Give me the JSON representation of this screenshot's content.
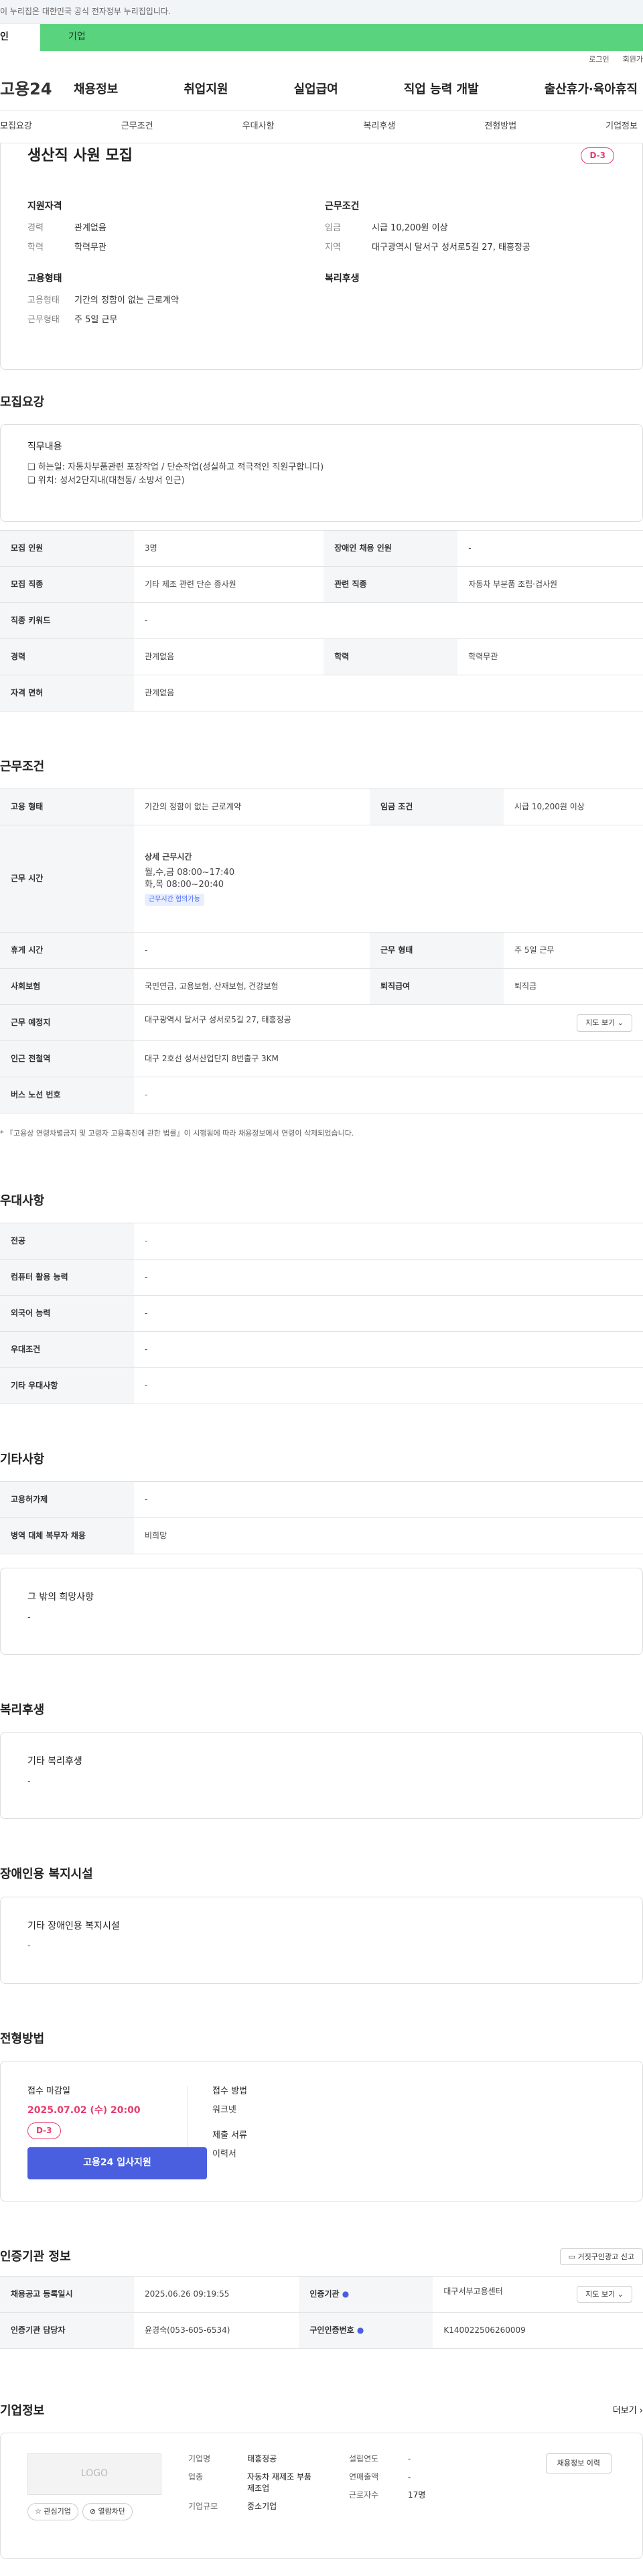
{
  "notice": "이 누리집은 대한민국 공식 전자정부 누리집입니다.",
  "tabs": {
    "a": "인",
    "b": "기업"
  },
  "topmenu": [
    "로그인",
    "회원가"
  ],
  "gnb": {
    "logo": "고용24",
    "items": [
      "채용정보",
      "취업지원",
      "실업급여",
      "직업 능력 개발",
      "출산휴가·육아휴직"
    ]
  },
  "subnav": [
    "모집요강",
    "근무조건",
    "우대사항",
    "복리후생",
    "전형방법",
    "기업정보"
  ],
  "job": {
    "title": "생산직 사원 모집",
    "dday": "D-3",
    "summary": {
      "left_head": "지원자격",
      "right_head": "근무조건",
      "rows": [
        [
          "경력",
          "관계없음",
          "임금",
          "시급 10,200원 이상"
        ],
        [
          "학력",
          "학력무관",
          "지역",
          "대구광역시 달서구 성서로5길 27, 태흥정공"
        ]
      ],
      "left_head2": "고용형태",
      "right_head2": "복리후생",
      "rows2": [
        [
          "고용형태",
          "기간의 정함이 없는 근로계약"
        ],
        [
          "근무형태",
          "주 5일 근무"
        ]
      ]
    }
  },
  "recruit": {
    "title": "모집요강",
    "duty_label": "직무내용",
    "duty_lines": [
      "❏ 하는일: 자동차부품관련 포장작업 / 단순작업(성실하고 적극적인 직원구합니다)",
      "❏ 위치: 성서2단지내(대천동/ 소방서 인근)"
    ],
    "rows": [
      [
        "모집 인원",
        "3명",
        "장애인 채용 인원",
        "-"
      ],
      [
        "모집 직종",
        "기타 제조 관련 단순 종사원",
        "관련 직종",
        "자동차 부분품 조립·검사원"
      ],
      [
        "직종 키워드",
        "-"
      ],
      [
        "경력",
        "관계없음",
        "학력",
        "학력무관"
      ],
      [
        "자격 면허",
        "관계없음"
      ]
    ]
  },
  "cond": {
    "title": "근무조건",
    "r1": [
      "고용 형태",
      "기간의 정함이 없는 근로계약",
      "임금 조건",
      "시급 10,200원 이상"
    ],
    "hours_label": "근무 시간",
    "hours_head": "상세 근무시간",
    "hours_lines": [
      "월,수,금 08:00~17:40",
      "화,목 08:00~20:40"
    ],
    "hours_chip": "근무시간 협의가능",
    "rows": [
      [
        "휴게 시간",
        "-",
        "근무 형태",
        "주 5일 근무"
      ],
      [
        "사회보험",
        "국민연금, 고용보험, 산재보험, 건강보험",
        "퇴직급여",
        "퇴직금"
      ]
    ],
    "place": [
      "근무 예정지",
      "대구광역시 달서구 성서로5길 27, 태흥정공",
      "지도 보기"
    ],
    "subway": [
      "인근 전철역",
      "대구 2호선 성서산업단지 8번출구 3KM"
    ],
    "bus": [
      "버스 노선 번호",
      "-"
    ],
    "note": "* 『고용상 연령차별금지 및 고령자 고용촉진에 관한 법률』이 시행됨에 따라 채용정보에서 연령이 삭제되었습니다."
  },
  "pref": {
    "title": "우대사항",
    "rows": [
      [
        "전공",
        "-"
      ],
      [
        "컴퓨터 활용 능력",
        "-"
      ],
      [
        "외국어 능력",
        "-"
      ],
      [
        "우대조건",
        "-"
      ],
      [
        "기타 우대사항",
        "-"
      ]
    ]
  },
  "etc": {
    "title": "기타사항",
    "rows": [
      [
        "고용허가제",
        "-"
      ],
      [
        "병역 대체 복무자 채용",
        "비희망"
      ]
    ],
    "box_title": "그 밖의 희망사항",
    "box_value": "-"
  },
  "welfare": {
    "title": "복리후생",
    "box_title": "기타 복리후생",
    "box_value": "-"
  },
  "disab": {
    "title": "장애인용 복지시설",
    "box_title": "기타 장애인용 복지시설",
    "box_value": "-"
  },
  "select": {
    "title": "전형방법",
    "deadline_label": "접수 마감일",
    "deadline": "2025.07.02 (수) 20:00",
    "dday": "D-3",
    "apply_btn": "고용24 입사지원",
    "method_label": "접수 방법",
    "method": "워크넷",
    "docs_label": "제출 서류",
    "docs": "이력서"
  },
  "agency": {
    "title": "인증기관 정보",
    "report_btn": "거짓구인광고 신고",
    "rows": [
      [
        "채용공고 등록일시",
        "2025.06.26 09:19:55",
        "인증기관",
        "대구서부고용센터",
        "지도 보기"
      ],
      [
        "인증기관 담당자",
        "윤경숙(053-605-6534)",
        "구인인증번호",
        "K140022506260009"
      ]
    ]
  },
  "companyinfo": {
    "title": "기업정보",
    "more": "더보기 ›",
    "logo": "LOGO",
    "fav_btn": "☆ 관심기업",
    "block_btn": "⊘ 열람차단",
    "fields": {
      "name_k": "기업명",
      "name": "태흥정공",
      "ind_k": "업종",
      "ind": "자동차 재제조 부품 제조업",
      "size_k": "기업규모",
      "size": "중소기업",
      "year_k": "설립연도",
      "year": "-",
      "sales_k": "연매출액",
      "sales": "-",
      "emp_k": "근로자수",
      "emp": "17명"
    },
    "history_btn": "채용정보 이력"
  }
}
